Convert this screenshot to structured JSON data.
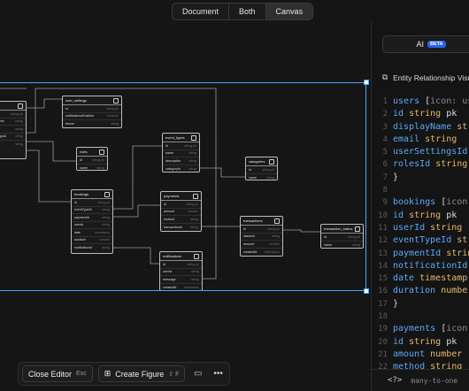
{
  "view_toggle": {
    "options": [
      "Document",
      "Both",
      "Canvas"
    ],
    "active": "Canvas"
  },
  "entities": {
    "users": {
      "rows": [
        [
          "id",
          "string pk"
        ],
        [
          "displayName",
          "string"
        ],
        [
          "email",
          "string"
        ],
        [
          "userSettingsId",
          "string"
        ],
        [
          "rolesId",
          "string"
        ]
      ]
    },
    "user_settings": {
      "title": "user_settings",
      "rows": [
        [
          "id",
          "string pk"
        ],
        [
          "notificationsEnabled",
          "boolean"
        ],
        [
          "theme",
          "string"
        ]
      ]
    },
    "roles": {
      "title": "roles",
      "rows": [
        [
          "id",
          "string pk"
        ],
        [
          "name",
          "string"
        ]
      ]
    },
    "event_types": {
      "title": "event_types",
      "rows": [
        [
          "id",
          "string pk"
        ],
        [
          "name",
          "string"
        ],
        [
          "description",
          "string"
        ],
        [
          "categoryId",
          "string"
        ]
      ]
    },
    "categories": {
      "title": "categories",
      "rows": [
        [
          "id",
          "string pk"
        ],
        [
          "name",
          "string"
        ]
      ]
    },
    "bookings": {
      "title": "bookings",
      "rows": [
        [
          "id",
          "string pk"
        ],
        [
          "eventTypeId",
          "string"
        ],
        [
          "paymentId",
          "string"
        ],
        [
          "userId",
          "string"
        ],
        [
          "date",
          "timestamp"
        ],
        [
          "duration",
          "number"
        ],
        [
          "notificationId",
          "string"
        ]
      ]
    },
    "payments": {
      "title": "payments",
      "rows": [
        [
          "id",
          "string pk"
        ],
        [
          "amount",
          "number"
        ],
        [
          "method",
          "string"
        ],
        [
          "transactionId",
          "string"
        ]
      ]
    },
    "transactions": {
      "title": "transactions",
      "rows": [
        [
          "id",
          "string pk"
        ],
        [
          "statusId",
          "string"
        ],
        [
          "amount",
          "number"
        ],
        [
          "createdAt",
          "timestamp"
        ]
      ]
    },
    "transaction_status": {
      "title": "transaction_status",
      "rows": [
        [
          "id",
          "string pk"
        ],
        [
          "name",
          "string"
        ]
      ]
    },
    "notifications": {
      "title": "notifications",
      "rows": [
        [
          "id",
          "string pk"
        ],
        [
          "userId",
          "string"
        ],
        [
          "message",
          "string"
        ],
        [
          "createdAt",
          "timestamp"
        ]
      ]
    }
  },
  "bottom_bar": {
    "close_label": "Close Editor",
    "close_kbd": "Esc",
    "create_label": "Create Figure",
    "create_kbd": "⇧ F"
  },
  "editor": {
    "ai_label": "AI",
    "beta": "BETA",
    "er_title": "Entity Relationship Visualization",
    "footer_relation": "many-to-one",
    "lines": [
      {
        "n": "1",
        "t": "users [icon: user, color: blue] {"
      },
      {
        "n": "2",
        "t": "  id string pk"
      },
      {
        "n": "3",
        "t": "  displayName string"
      },
      {
        "n": "4",
        "t": "  email string"
      },
      {
        "n": "5",
        "t": "  userSettingsId string"
      },
      {
        "n": "6",
        "t": "  rolesId string"
      },
      {
        "n": "7",
        "t": "}"
      },
      {
        "n": "8",
        "t": ""
      },
      {
        "n": "9",
        "t": "bookings [icon: calendar] {"
      },
      {
        "n": "10",
        "t": "  id string pk"
      },
      {
        "n": "11",
        "t": "  userId string"
      },
      {
        "n": "12",
        "t": "  eventTypeId string"
      },
      {
        "n": "13",
        "t": "  paymentId string"
      },
      {
        "n": "14",
        "t": "  notificationId string"
      },
      {
        "n": "15",
        "t": "  date timestamp"
      },
      {
        "n": "16",
        "t": "  duration number"
      },
      {
        "n": "17",
        "t": "}"
      },
      {
        "n": "18",
        "t": ""
      },
      {
        "n": "19",
        "t": "payments [icon: credit-card] {"
      },
      {
        "n": "20",
        "t": "  id string pk"
      },
      {
        "n": "21",
        "t": "  amount number"
      },
      {
        "n": "22",
        "t": "  method string"
      }
    ]
  }
}
